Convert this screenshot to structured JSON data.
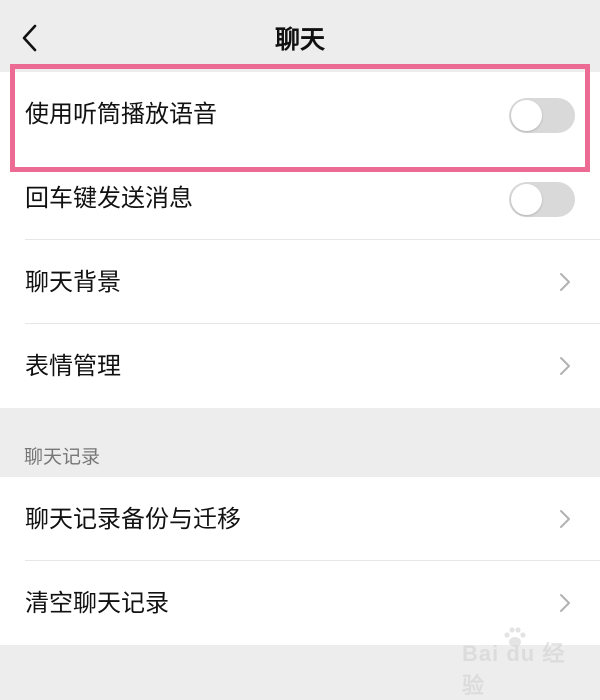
{
  "header": {
    "title": "聊天",
    "back_icon": "chevron-left-icon"
  },
  "general": {
    "items": [
      {
        "label": "使用听筒播放语音",
        "type": "toggle",
        "on": false
      },
      {
        "label": "回车键发送消息",
        "type": "toggle",
        "on": false
      },
      {
        "label": "聊天背景",
        "type": "link"
      },
      {
        "label": "表情管理",
        "type": "link"
      }
    ]
  },
  "chat_history": {
    "header": "聊天记录",
    "items": [
      {
        "label": "聊天记录备份与迁移",
        "type": "link"
      },
      {
        "label": "清空聊天记录",
        "type": "link"
      }
    ]
  },
  "highlight": {
    "color": "#ec6b94"
  },
  "watermark": {
    "text": "Bai du 经验"
  },
  "colors": {
    "background": "#ededed",
    "switch_off": "#d9d9d9",
    "chevron": "#b2b2b2"
  }
}
